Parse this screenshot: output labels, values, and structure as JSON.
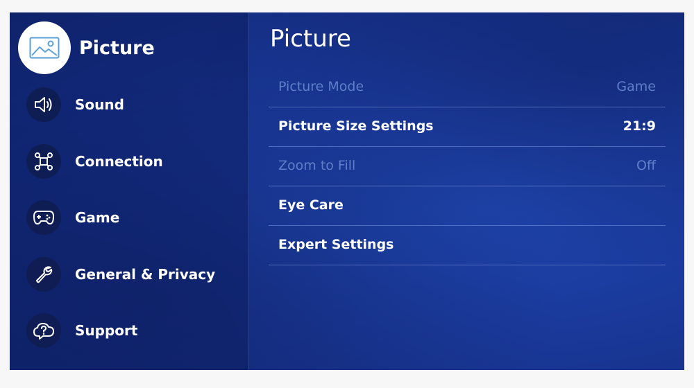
{
  "sidebar": {
    "items": [
      {
        "label": "Picture",
        "icon": "picture-icon",
        "active": true
      },
      {
        "label": "Sound",
        "icon": "speaker-icon",
        "active": false
      },
      {
        "label": "Connection",
        "icon": "connection-icon",
        "active": false
      },
      {
        "label": "Game",
        "icon": "gamepad-icon",
        "active": false
      },
      {
        "label": "General & Privacy",
        "icon": "wrench-icon",
        "active": false
      },
      {
        "label": "Support",
        "icon": "cloud-help-icon",
        "active": false
      }
    ]
  },
  "panel": {
    "title": "Picture",
    "rows": [
      {
        "label": "Picture Mode",
        "value": "Game",
        "enabled": false
      },
      {
        "label": "Picture Size Settings",
        "value": "21:9",
        "enabled": true
      },
      {
        "label": "Zoom to Fill",
        "value": "Off",
        "enabled": false
      },
      {
        "label": "Eye Care",
        "value": "",
        "enabled": true
      },
      {
        "label": "Expert Settings",
        "value": "",
        "enabled": true
      }
    ]
  },
  "colors": {
    "background": "#1a3a9c",
    "sidebar": "#102468",
    "text": "#ffffff",
    "disabled_text": "#5f7fc8",
    "active_icon_bg": "#ffffff"
  }
}
